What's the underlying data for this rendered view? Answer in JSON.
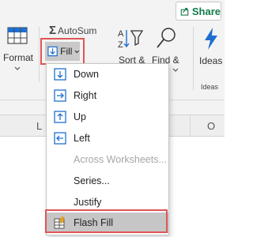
{
  "toolbar": {
    "share_label": "Share",
    "format_label": "Format",
    "autosum_label": "AutoSum",
    "fill_label": "Fill",
    "sort_label": "Sort &",
    "find_label": "Find &",
    "ideas_label": "Ideas",
    "ideas_group_label": "Ideas"
  },
  "columns": {
    "left": "L",
    "right": "O"
  },
  "fill_menu": {
    "items": [
      {
        "label": "Down",
        "icon": "fill-down-icon",
        "enabled": true
      },
      {
        "label": "Right",
        "icon": "fill-right-icon",
        "enabled": true
      },
      {
        "label": "Up",
        "icon": "fill-up-icon",
        "enabled": true
      },
      {
        "label": "Left",
        "icon": "fill-left-icon",
        "enabled": true
      },
      {
        "label": "Across Worksheets...",
        "icon": "",
        "enabled": false
      },
      {
        "label": "Series...",
        "icon": "",
        "enabled": true
      },
      {
        "label": "Justify",
        "icon": "",
        "enabled": true
      },
      {
        "label": "Flash Fill",
        "icon": "flash-fill-icon",
        "enabled": true
      }
    ]
  },
  "colors": {
    "accent_green": "#127a4a",
    "highlight_red": "#e05555",
    "icon_blue": "#1f6fd0"
  }
}
